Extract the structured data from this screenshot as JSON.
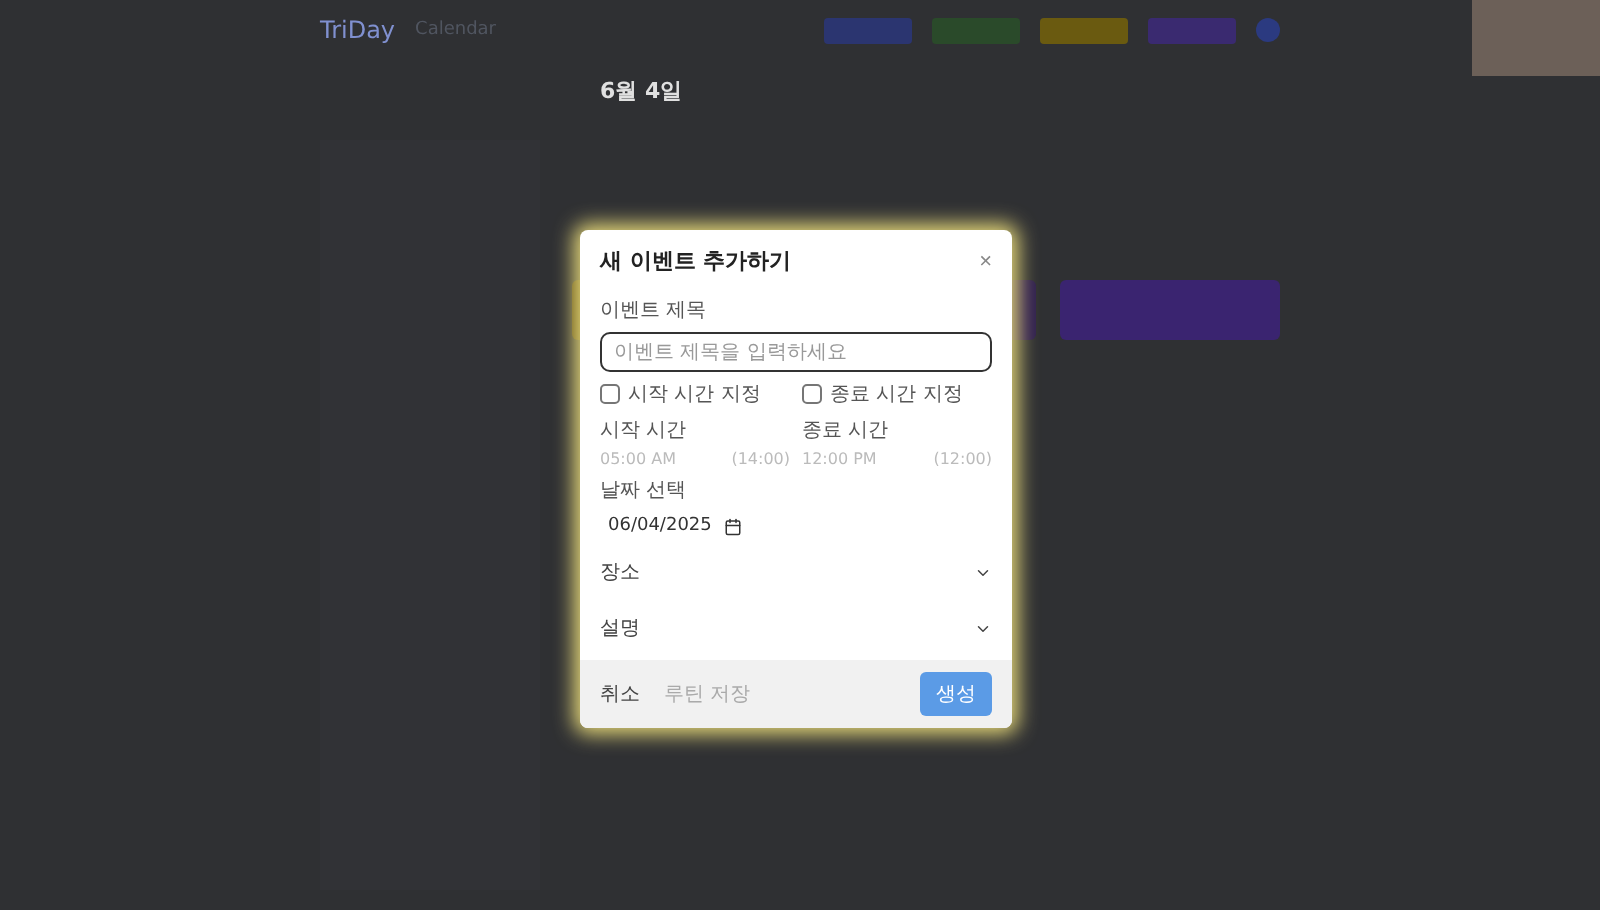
{
  "header": {
    "logo": "TriDay",
    "logo_sub": "Calendar"
  },
  "date_nav": {
    "date": "6월 4일"
  },
  "modal": {
    "title": "새 이벤트 추가하기",
    "close": "×",
    "title_field": {
      "label": "이벤트 제목",
      "placeholder": "이벤트 제목을 입력하세요"
    },
    "time_toggles": [
      {
        "label": "시작 시간 지정",
        "checked": false
      },
      {
        "label": "종료 시간 지정",
        "checked": false
      }
    ],
    "times": [
      {
        "label": "시작 시간",
        "value": "05:00 AM",
        "hint": "(14:00)",
        "disabled": true
      },
      {
        "label": "종료 시간",
        "value": "12:00 PM",
        "hint": "(12:00)",
        "disabled": true
      }
    ],
    "date_field": {
      "label": "날짜 선택",
      "value": "06/04/2025"
    },
    "sections": [
      {
        "label": "장소",
        "expanded": false
      },
      {
        "label": "설명",
        "expanded": false
      }
    ],
    "footer": {
      "cancel": "취소",
      "save_routine": "루틴 저장",
      "create": "생성"
    }
  }
}
